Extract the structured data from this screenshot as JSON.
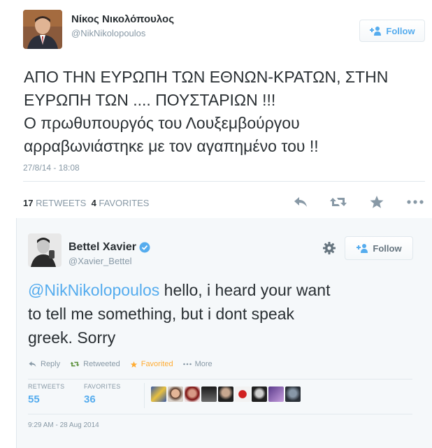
{
  "tweet1": {
    "author_name": "Νίκος Νικολόπουλος",
    "author_handle": "@NikNikolopoulos",
    "follow_label": "Follow",
    "text_lines": [
      "ΑΠΟ ΤΗΝ ΕΥΡΩΠΗ ΤΩΝ ΕΘΝΩΝ-ΚΡΑΤΩΝ, ΣΤΗΝ",
      "ΕΥΡΩΠΗ ΤΩΝ .... ΠΟΥΣΤΑΡΙΩΝ !!!",
      "Ο πρωθυπουργός του Λουξεμβούργου",
      "αρραβωνιάστηκε με τον αγαπημένο του !!"
    ],
    "timestamp": "27/8/14 - 18:08",
    "retweets_count": "17",
    "retweets_label": "RETWEETS",
    "favorites_count": "4",
    "favorites_label": "FAVORITES",
    "action_icons": [
      "reply-icon",
      "retweet-icon",
      "favorite-star-icon",
      "more-dots-icon"
    ]
  },
  "tweet2": {
    "author_name": "Bettel Xavier",
    "author_handle": "@Xavier_Bettel",
    "follow_label": "Follow",
    "text_mention": "@NikNikolopoulos",
    "text_line1_rest": " hello, i heard your want",
    "text_line2": "to tell me something, but i dont speak",
    "text_line3": "greek. Sorry",
    "actions": {
      "reply": "Reply",
      "retweeted": "Retweeted",
      "favorited": "Favorited",
      "more": "More"
    },
    "retweets_label": "RETWEETS",
    "retweets_count": "55",
    "favorites_label": "FAVORITES",
    "favorites_count": "36",
    "datetime": "9:29 AM - 28 Aug 2014",
    "colors": {
      "accent": "#55acee",
      "favorite": "#ffac33",
      "verified": "#55acee"
    }
  }
}
